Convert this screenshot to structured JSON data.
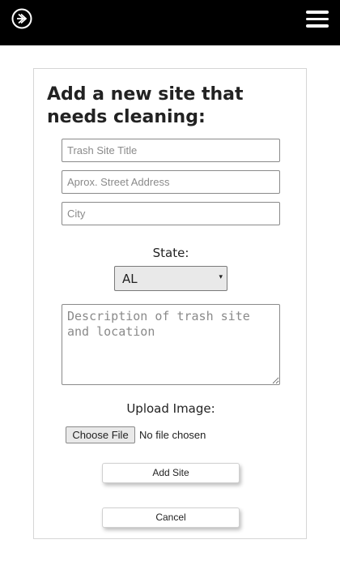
{
  "header": {
    "logo_icon": "circle-arrow-right-icon",
    "menu_icon": "hamburger-menu-icon",
    "background": "#000000"
  },
  "form": {
    "title": "Add a new site that needs cleaning:",
    "title_input": {
      "placeholder": "Trash Site Title",
      "value": ""
    },
    "address_input": {
      "placeholder": "Aprox. Street Address",
      "value": ""
    },
    "city_input": {
      "placeholder": "City",
      "value": ""
    },
    "state_label": "State:",
    "state_select": {
      "selected": "AL",
      "arrow": "▾"
    },
    "description_input": {
      "placeholder": "Description of trash site and location",
      "value": ""
    },
    "upload_label": "Upload Image:",
    "file_button_label": "Choose File",
    "file_status": "No file chosen",
    "submit_label": "Add Site",
    "cancel_label": "Cancel"
  }
}
